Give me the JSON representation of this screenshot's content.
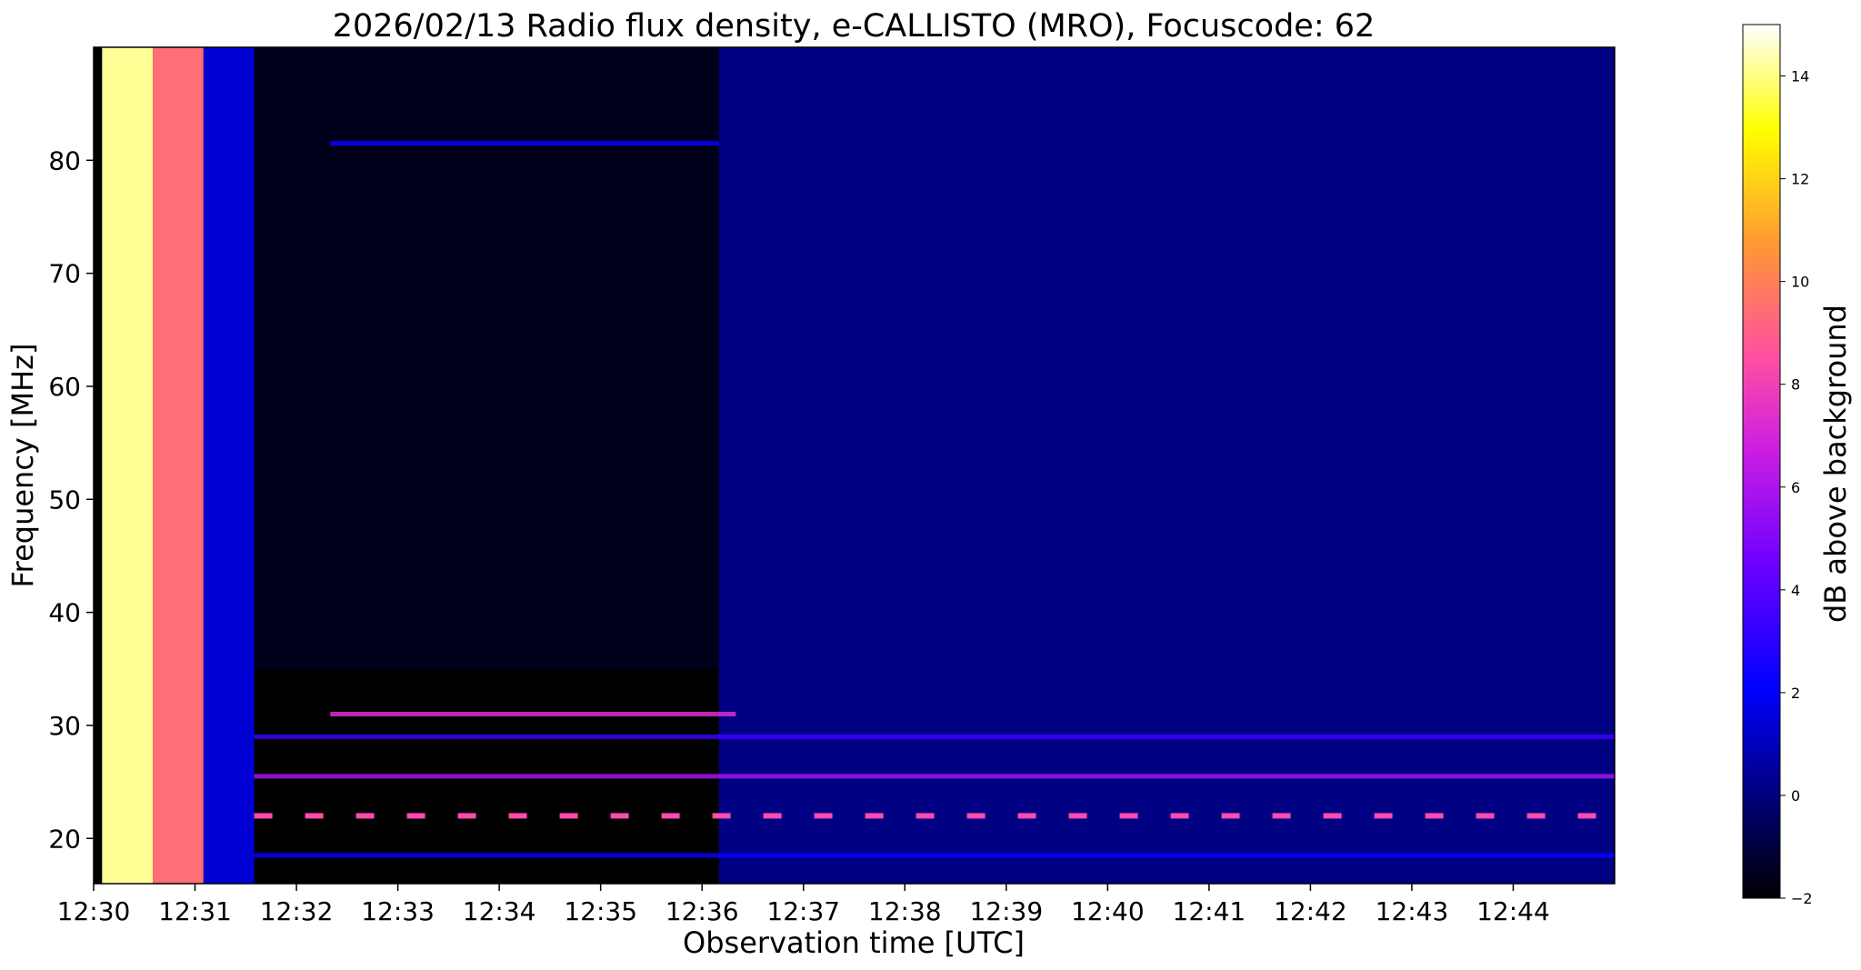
{
  "chart_data": {
    "type": "heatmap",
    "title": "2026/02/13  Radio flux density, e-CALLISTO (MRO), Focuscode: 62",
    "xlabel": "Observation time [UTC]",
    "ylabel": "Frequency [MHz]",
    "x_range": [
      "12:30:00",
      "12:45:00"
    ],
    "y_range": [
      16,
      90
    ],
    "x_ticks": [
      "12:30",
      "12:31",
      "12:32",
      "12:33",
      "12:34",
      "12:35",
      "12:36",
      "12:37",
      "12:38",
      "12:39",
      "12:40",
      "12:41",
      "12:42",
      "12:43",
      "12:44"
    ],
    "y_ticks": [
      20,
      30,
      40,
      50,
      60,
      70,
      80
    ],
    "colorbar": {
      "label": "dB above background",
      "range": [
        -2,
        15
      ],
      "ticks": [
        -2,
        0,
        2,
        4,
        6,
        8,
        10,
        12,
        14
      ],
      "colormap": "gnuplot2",
      "colors": [
        "#000000",
        "#00007f",
        "#0000ff",
        "#8000ff",
        "#ff40c0",
        "#ff9933",
        "#ffff00",
        "#ffffff"
      ]
    },
    "regions": [
      {
        "time": [
          "12:30:00",
          "12:30:05"
        ],
        "freq": [
          16,
          90
        ],
        "db": -2,
        "desc": "black strip"
      },
      {
        "time": [
          "12:30:05",
          "12:30:35"
        ],
        "freq": [
          16,
          90
        ],
        "db": 14,
        "desc": "saturated white/yellow"
      },
      {
        "time": [
          "12:30:35",
          "12:31:05"
        ],
        "freq": [
          16,
          90
        ],
        "db": 9,
        "desc": "orange/pink"
      },
      {
        "time": [
          "12:31:05",
          "12:31:35"
        ],
        "freq": [
          16,
          90
        ],
        "db": 2,
        "desc": "blue"
      },
      {
        "time": [
          "12:31:35",
          "12:36:10"
        ],
        "freq": [
          35,
          90
        ],
        "db": -1.5,
        "desc": "dark background"
      },
      {
        "time": [
          "12:36:10",
          "12:45:00"
        ],
        "freq": [
          16,
          90
        ],
        "db": 0.5,
        "desc": "dark blue background"
      }
    ],
    "bands": [
      {
        "freq": 22,
        "db": 8,
        "desc": "periodic interference dashes"
      },
      {
        "freq": 25.5,
        "db": 6,
        "desc": "interference"
      },
      {
        "freq": 29,
        "db": 4
      },
      {
        "freq": 31,
        "db": 7,
        "time": [
          "12:32:20",
          "12:36:20"
        ]
      },
      {
        "freq": 18.5,
        "db": 3
      },
      {
        "freq": 81.5,
        "db": 3,
        "time": [
          "12:32:20",
          "12:36:10"
        ]
      }
    ]
  }
}
